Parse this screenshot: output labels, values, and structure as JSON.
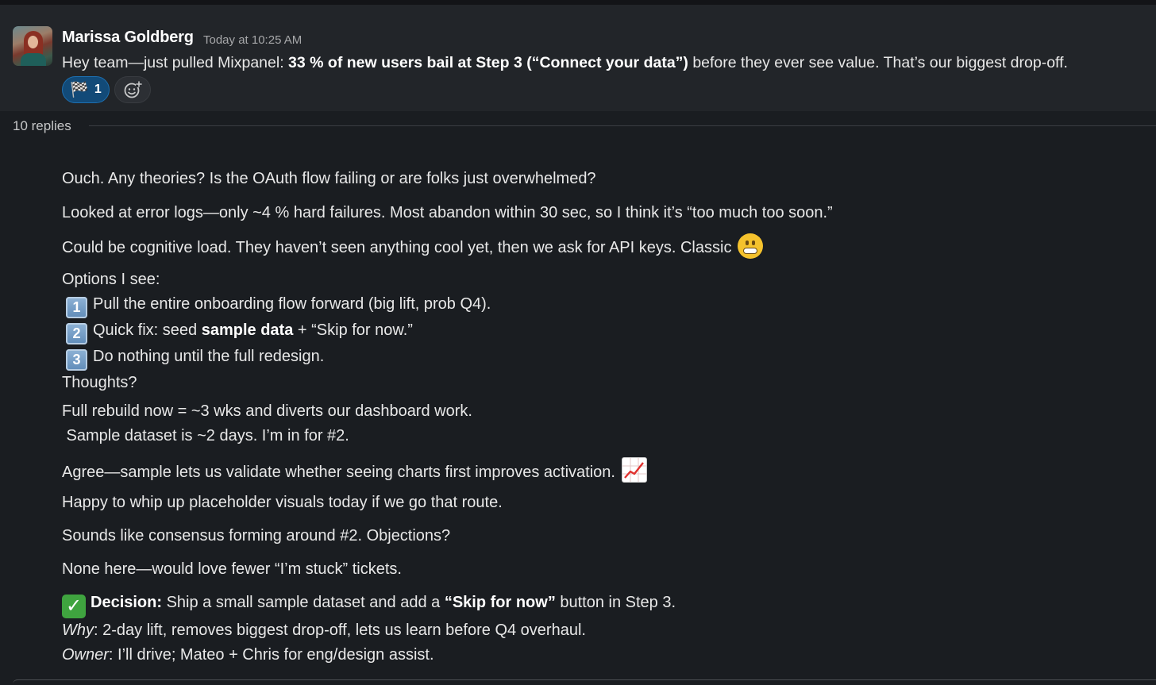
{
  "parent": {
    "author": "Marissa Goldberg",
    "timestamp": "Today at 10:25 AM",
    "text_pre": "Hey team—just pulled Mixpanel: ",
    "text_bold": "33 % of new users bail at Step 3 (“Connect your data”)",
    "text_post": " before they ever see value. That’s our biggest drop-off.",
    "reaction": {
      "emoji": "🏁",
      "count": "1"
    }
  },
  "thread": {
    "replies_label": "10 replies",
    "m1": "Ouch. Any theories? Is the OAuth flow failing or are folks just overwhelmed?",
    "m2": "Looked at error logs—only ~4 % hard failures. Most abandon within 30 sec, so I think it’s “too much too soon.”",
    "m3": "Could be cognitive load. They haven’t seen anything cool yet, then we ask for API keys. Classic ",
    "m4": {
      "intro": "Options I see:",
      "opt1_key": "1",
      "opt1": "Pull the entire onboarding flow forward (big lift, prob Q4).",
      "opt2_key": "2",
      "opt2_pre": "Quick fix: seed ",
      "opt2_bold": "sample data",
      "opt2_post": " + “Skip for now.”",
      "opt3_key": "3",
      "opt3": "Do nothing until the full redesign.",
      "outro": "Thoughts?"
    },
    "m5": {
      "line1": "Full rebuild now = ~3 wks and diverts our dashboard work.",
      "line2": " Sample dataset is ~2 days. I’m in for #2."
    },
    "m6": "Agree—sample lets us validate whether seeing charts first improves activation. ",
    "m7": "Happy to whip up placeholder visuals today if we go that route.",
    "m8": "Sounds like consensus forming around #2. Objections?",
    "m9": "None here—would love fewer “I’m stuck” tickets.",
    "m10": {
      "decision_label": "Decision:",
      "decision_pre": " Ship a small sample dataset and add a ",
      "decision_bold": "“Skip for now”",
      "decision_post": " button in Step 3.",
      "why_label": "Why",
      "why_text": ": 2-day lift, removes biggest drop-off, lets us learn before Q4 overhaul.",
      "owner_label": "Owner",
      "owner_text": ": I’ll drive; Mateo + Chris for eng/design assist."
    }
  }
}
